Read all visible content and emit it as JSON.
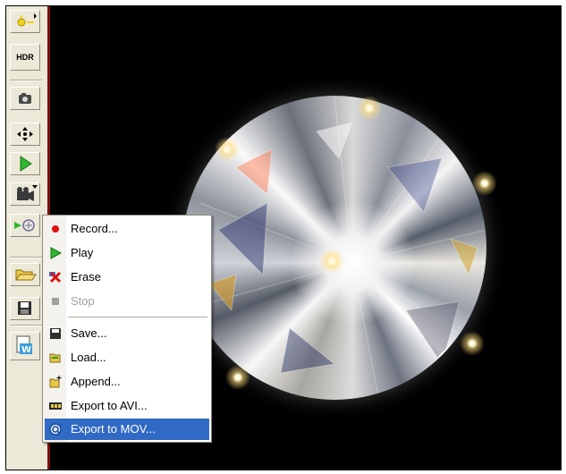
{
  "toolbar": {
    "hdr_label": "HDR",
    "buttons": [
      "lights-icon",
      "hdr-button",
      "camera-icon",
      "move-icon",
      "play-icon",
      "video-camera-icon",
      "record-settings-icon",
      "open-folder-icon",
      "save-icon",
      "export-icon"
    ]
  },
  "menu": {
    "items": [
      {
        "label": "Record...",
        "icon": "record-dot-icon",
        "enabled": true
      },
      {
        "label": "Play",
        "icon": "play-icon",
        "enabled": true
      },
      {
        "label": "Erase",
        "icon": "erase-x-icon",
        "enabled": true
      },
      {
        "label": "Stop",
        "icon": "stop-icon",
        "enabled": false
      },
      {
        "label": "Save...",
        "icon": "floppy-icon",
        "enabled": true
      },
      {
        "label": "Load...",
        "icon": "load-folder-icon",
        "enabled": true
      },
      {
        "label": "Append...",
        "icon": "append-folder-icon",
        "enabled": true
      },
      {
        "label": "Export to AVI...",
        "icon": "film-icon",
        "enabled": true
      },
      {
        "label": "Export to MOV...",
        "icon": "quicktime-icon",
        "enabled": true,
        "highlighted": true
      }
    ]
  },
  "colors": {
    "menu_highlight": "#316ac5",
    "toolbar_bg": "#ece9d8",
    "viewport_bg": "#000000"
  }
}
